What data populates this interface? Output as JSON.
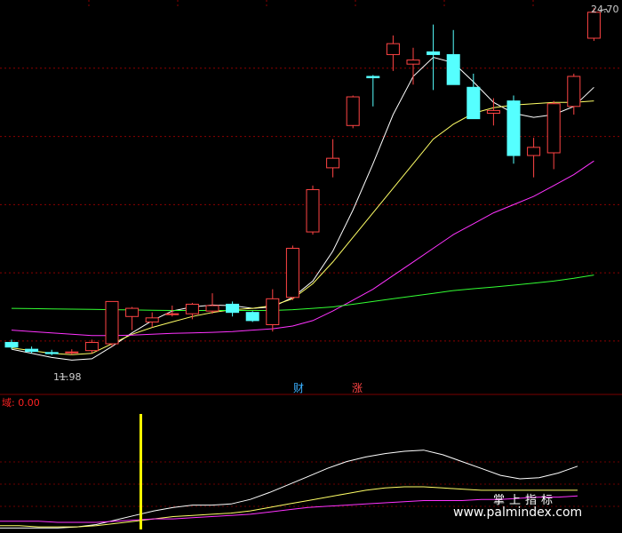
{
  "chart_data": [
    {
      "type": "candlestick",
      "annotations": {
        "high_label": "24.70",
        "low_label": "11.98",
        "marker_1": "财",
        "marker_2": "涨"
      },
      "ylim": [
        11.0,
        25.0
      ],
      "candles": [
        {
          "o": 12.45,
          "h": 12.55,
          "l": 12.2,
          "c": 12.28
        },
        {
          "o": 12.2,
          "h": 12.3,
          "l": 12.05,
          "c": 12.12
        },
        {
          "o": 12.08,
          "h": 12.18,
          "l": 11.98,
          "c": 12.04
        },
        {
          "o": 12.1,
          "h": 12.2,
          "l": 12.0,
          "c": 12.1
        },
        {
          "o": 12.15,
          "h": 12.55,
          "l": 12.05,
          "c": 12.45
        },
        {
          "o": 12.4,
          "h": 13.95,
          "l": 12.3,
          "c": 13.95
        },
        {
          "o": 13.4,
          "h": 13.75,
          "l": 12.9,
          "c": 13.7
        },
        {
          "o": 13.2,
          "h": 13.55,
          "l": 13.0,
          "c": 13.35
        },
        {
          "o": 13.5,
          "h": 13.8,
          "l": 13.4,
          "c": 13.5
        },
        {
          "o": 13.5,
          "h": 13.9,
          "l": 13.3,
          "c": 13.85
        },
        {
          "o": 13.6,
          "h": 14.25,
          "l": 13.5,
          "c": 13.8
        },
        {
          "o": 13.85,
          "h": 13.95,
          "l": 13.4,
          "c": 13.55
        },
        {
          "o": 13.55,
          "h": 13.6,
          "l": 13.2,
          "c": 13.25
        },
        {
          "o": 13.1,
          "h": 14.4,
          "l": 12.85,
          "c": 14.05
        },
        {
          "o": 14.1,
          "h": 16.0,
          "l": 14.0,
          "c": 15.9
        },
        {
          "o": 16.5,
          "h": 18.2,
          "l": 16.4,
          "c": 18.05
        },
        {
          "o": 18.85,
          "h": 19.9,
          "l": 18.5,
          "c": 19.2
        },
        {
          "o": 20.4,
          "h": 21.5,
          "l": 20.3,
          "c": 21.45
        },
        {
          "o": 22.2,
          "h": 22.25,
          "l": 21.1,
          "c": 22.15
        },
        {
          "o": 23.0,
          "h": 23.7,
          "l": 22.4,
          "c": 23.4
        },
        {
          "o": 22.65,
          "h": 23.25,
          "l": 21.9,
          "c": 22.8
        },
        {
          "o": 23.1,
          "h": 24.1,
          "l": 21.7,
          "c": 23.0
        },
        {
          "o": 23.0,
          "h": 23.9,
          "l": 22.0,
          "c": 21.9
        },
        {
          "o": 21.8,
          "h": 22.3,
          "l": 20.9,
          "c": 20.65
        },
        {
          "o": 20.85,
          "h": 21.4,
          "l": 20.4,
          "c": 20.95
        },
        {
          "o": 21.3,
          "h": 21.5,
          "l": 19.0,
          "c": 19.3
        },
        {
          "o": 19.3,
          "h": 19.95,
          "l": 18.5,
          "c": 19.6
        },
        {
          "o": 19.4,
          "h": 21.3,
          "l": 18.8,
          "c": 21.2
        },
        {
          "o": 21.1,
          "h": 22.3,
          "l": 20.8,
          "c": 22.2
        },
        {
          "o": 23.6,
          "h": 24.7,
          "l": 23.5,
          "c": 24.55
        }
      ],
      "series": [
        {
          "color": "#ffffff",
          "values": [
            12.2,
            12.05,
            11.9,
            11.8,
            11.85,
            12.3,
            12.8,
            13.25,
            13.6,
            13.75,
            13.82,
            13.8,
            13.7,
            13.75,
            14.1,
            14.7,
            15.8,
            17.3,
            19.0,
            20.8,
            22.2,
            22.9,
            22.7,
            22.0,
            21.25,
            20.85,
            20.7,
            20.8,
            21.1,
            21.8
          ]
        },
        {
          "color": "#ffff66",
          "values": [
            12.25,
            12.15,
            12.05,
            12.0,
            12.05,
            12.4,
            12.75,
            13.0,
            13.2,
            13.4,
            13.55,
            13.65,
            13.7,
            13.8,
            14.05,
            14.6,
            15.4,
            16.3,
            17.2,
            18.1,
            19.0,
            19.9,
            20.45,
            20.85,
            21.05,
            21.15,
            21.2,
            21.25,
            21.25,
            21.3
          ]
        },
        {
          "color": "#ff33ff",
          "values": [
            12.9,
            12.85,
            12.8,
            12.75,
            12.7,
            12.7,
            12.72,
            12.75,
            12.78,
            12.8,
            12.82,
            12.85,
            12.9,
            12.95,
            13.05,
            13.25,
            13.6,
            14.0,
            14.4,
            14.9,
            15.4,
            15.9,
            16.4,
            16.8,
            17.2,
            17.5,
            17.8,
            18.2,
            18.6,
            19.1
          ]
        },
        {
          "color": "#33ff33",
          "values": [
            13.7,
            13.69,
            13.68,
            13.67,
            13.66,
            13.65,
            13.64,
            13.63,
            13.62,
            13.62,
            13.62,
            13.62,
            13.62,
            13.62,
            13.65,
            13.7,
            13.75,
            13.85,
            13.95,
            14.05,
            14.15,
            14.25,
            14.35,
            14.42,
            14.48,
            14.55,
            14.62,
            14.7,
            14.8,
            14.92
          ]
        }
      ]
    },
    {
      "type": "line",
      "title": "域: 0.00",
      "title_color": "#ff2222",
      "ylim": [
        0,
        100
      ],
      "series": [
        {
          "color": "#ffffff",
          "values": [
            2,
            2,
            2,
            2,
            3,
            5,
            9,
            13,
            17,
            20,
            22,
            22,
            23,
            27,
            33,
            40,
            47,
            54,
            60,
            64,
            67,
            69,
            70,
            66,
            60,
            54,
            48,
            45,
            46,
            50,
            56
          ]
        },
        {
          "color": "#ffff66",
          "values": [
            4,
            4,
            3,
            3,
            3,
            4,
            6,
            8,
            10,
            12,
            13,
            14,
            15,
            17,
            20,
            23,
            26,
            29,
            32,
            35,
            37,
            38,
            38,
            37,
            36,
            35,
            35,
            35,
            35,
            35,
            35
          ]
        },
        {
          "color": "#ff33ff",
          "values": [
            8,
            8,
            8,
            7,
            7,
            7,
            8,
            9,
            10,
            10,
            11,
            12,
            13,
            14,
            16,
            18,
            20,
            21,
            22,
            23,
            24,
            25,
            26,
            26,
            26,
            27,
            27,
            28,
            29,
            29,
            30
          ]
        }
      ],
      "marker_bar": {
        "color": "#ffff00"
      }
    }
  ],
  "watermark": {
    "title": "掌上指标",
    "url": "www.palmindex.com"
  }
}
